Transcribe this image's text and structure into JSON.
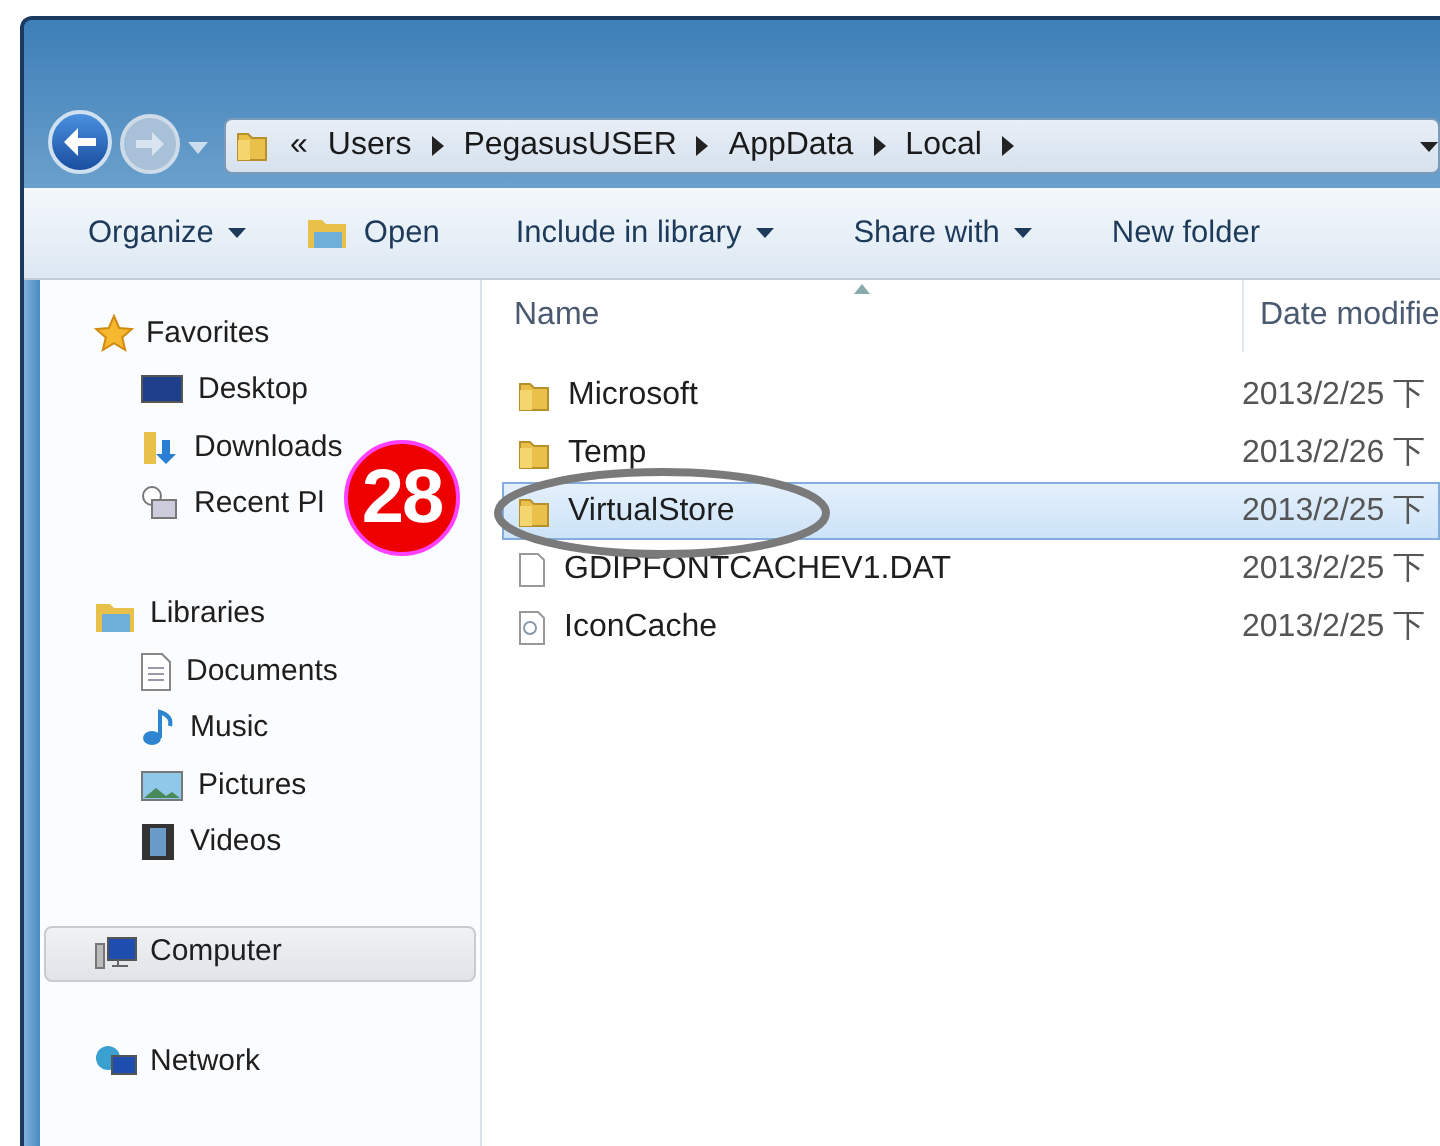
{
  "address_bar": {
    "crumbs": [
      "«",
      "Users",
      "PegasusUSER",
      "AppData",
      "Local"
    ]
  },
  "toolbar": [
    {
      "label": "Organize",
      "dropdown": true,
      "kind": "menu"
    },
    {
      "label": "Open",
      "dropdown": false,
      "kind": "open"
    },
    {
      "label": "Include in library",
      "dropdown": true,
      "kind": "menu"
    },
    {
      "label": "Share with",
      "dropdown": true,
      "kind": "menu"
    },
    {
      "label": "New folder",
      "dropdown": false,
      "kind": "menu"
    }
  ],
  "sidebar": {
    "groups": [
      {
        "label": "Favorites",
        "kind": "star",
        "selected": false,
        "children": [
          {
            "label": "Desktop",
            "kind": "desktop"
          },
          {
            "label": "Downloads",
            "kind": "downloads"
          },
          {
            "label": "Recent Pl",
            "kind": "recent"
          }
        ]
      },
      {
        "label": "Libraries",
        "kind": "libraries",
        "selected": false,
        "children": [
          {
            "label": "Documents",
            "kind": "documents"
          },
          {
            "label": "Music",
            "kind": "music"
          },
          {
            "label": "Pictures",
            "kind": "pictures"
          },
          {
            "label": "Videos",
            "kind": "videos"
          }
        ]
      },
      {
        "label": "Computer",
        "kind": "computer",
        "selected": true
      },
      {
        "label": "Network",
        "kind": "network",
        "selected": false
      }
    ]
  },
  "table": {
    "columns": [
      "Name",
      "Date modifie"
    ],
    "rows": [
      {
        "name": "Microsoft",
        "date": "2013/2/25 下",
        "kind": "folder",
        "selected": false
      },
      {
        "name": "Temp",
        "date": "2013/2/26 下",
        "kind": "folder",
        "selected": false
      },
      {
        "name": "VirtualStore",
        "date": "2013/2/25 下",
        "kind": "folder",
        "selected": true
      },
      {
        "name": "GDIPFONTCACHEV1.DAT",
        "date": "2013/2/25 下",
        "kind": "file",
        "selected": false
      },
      {
        "name": "IconCache",
        "date": "2013/2/25 下",
        "kind": "cache",
        "selected": false
      }
    ]
  },
  "annotation": {
    "badge": "28"
  }
}
